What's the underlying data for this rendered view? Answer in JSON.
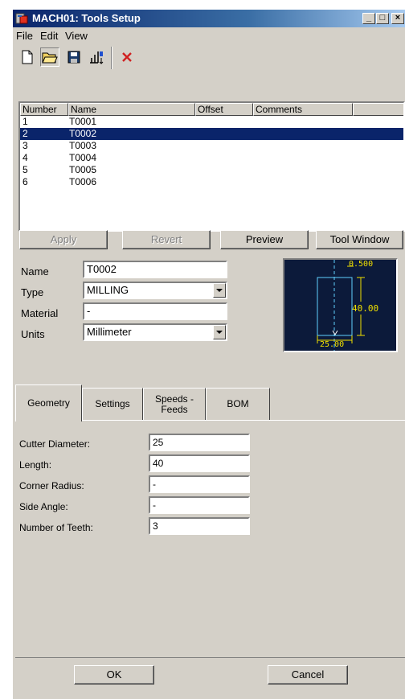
{
  "window": {
    "title": "MACH01: Tools Setup"
  },
  "menu": {
    "items": [
      "File",
      "Edit",
      "View"
    ]
  },
  "toolbar": {
    "buttons": [
      "new-icon",
      "open-folder-icon",
      "save-icon",
      "sort-icon",
      "delete-icon"
    ]
  },
  "tool_list": {
    "columns": [
      "Number",
      "Name",
      "Offset",
      "Comments",
      ""
    ],
    "rows": [
      {
        "number": "1",
        "name": "T0001"
      },
      {
        "number": "2",
        "name": "T0002",
        "selected": true
      },
      {
        "number": "3",
        "name": "T0003"
      },
      {
        "number": "4",
        "name": "T0004"
      },
      {
        "number": "5",
        "name": "T0005"
      },
      {
        "number": "6",
        "name": "T0006"
      }
    ]
  },
  "actions": {
    "apply": "Apply",
    "revert": "Revert",
    "preview": "Preview",
    "tool_window": "Tool Window"
  },
  "properties": {
    "name_label": "Name",
    "name_value": "T0002",
    "type_label": "Type",
    "type_value": "MILLING",
    "material_label": "Material",
    "material_value": "-",
    "units_label": "Units",
    "units_value": "Millimeter"
  },
  "preview": {
    "dim_top": "0.500",
    "dim_right": "40.00",
    "dim_bottom": "25.00"
  },
  "tabs": {
    "geometry": "Geometry",
    "settings": "Settings",
    "speeds_line1": "Speeds -",
    "speeds_line2": "Feeds",
    "bom": "BOM"
  },
  "geometry": {
    "cutter_diameter_label": "Cutter Diameter:",
    "cutter_diameter_value": "25",
    "length_label": "Length:",
    "length_value": "40",
    "corner_radius_label": "Corner Radius:",
    "corner_radius_value": "-",
    "side_angle_label": "Side Angle:",
    "side_angle_value": "-",
    "teeth_label": "Number of Teeth:",
    "teeth_value": "3"
  },
  "footer": {
    "ok": "OK",
    "cancel": "Cancel"
  },
  "colors": {
    "title_bar": "#0a246a",
    "selection": "#0a246a",
    "preview_bg": "#0c1a3a",
    "preview_dim": "#f0e000",
    "preview_outline": "#5fd0ff"
  }
}
